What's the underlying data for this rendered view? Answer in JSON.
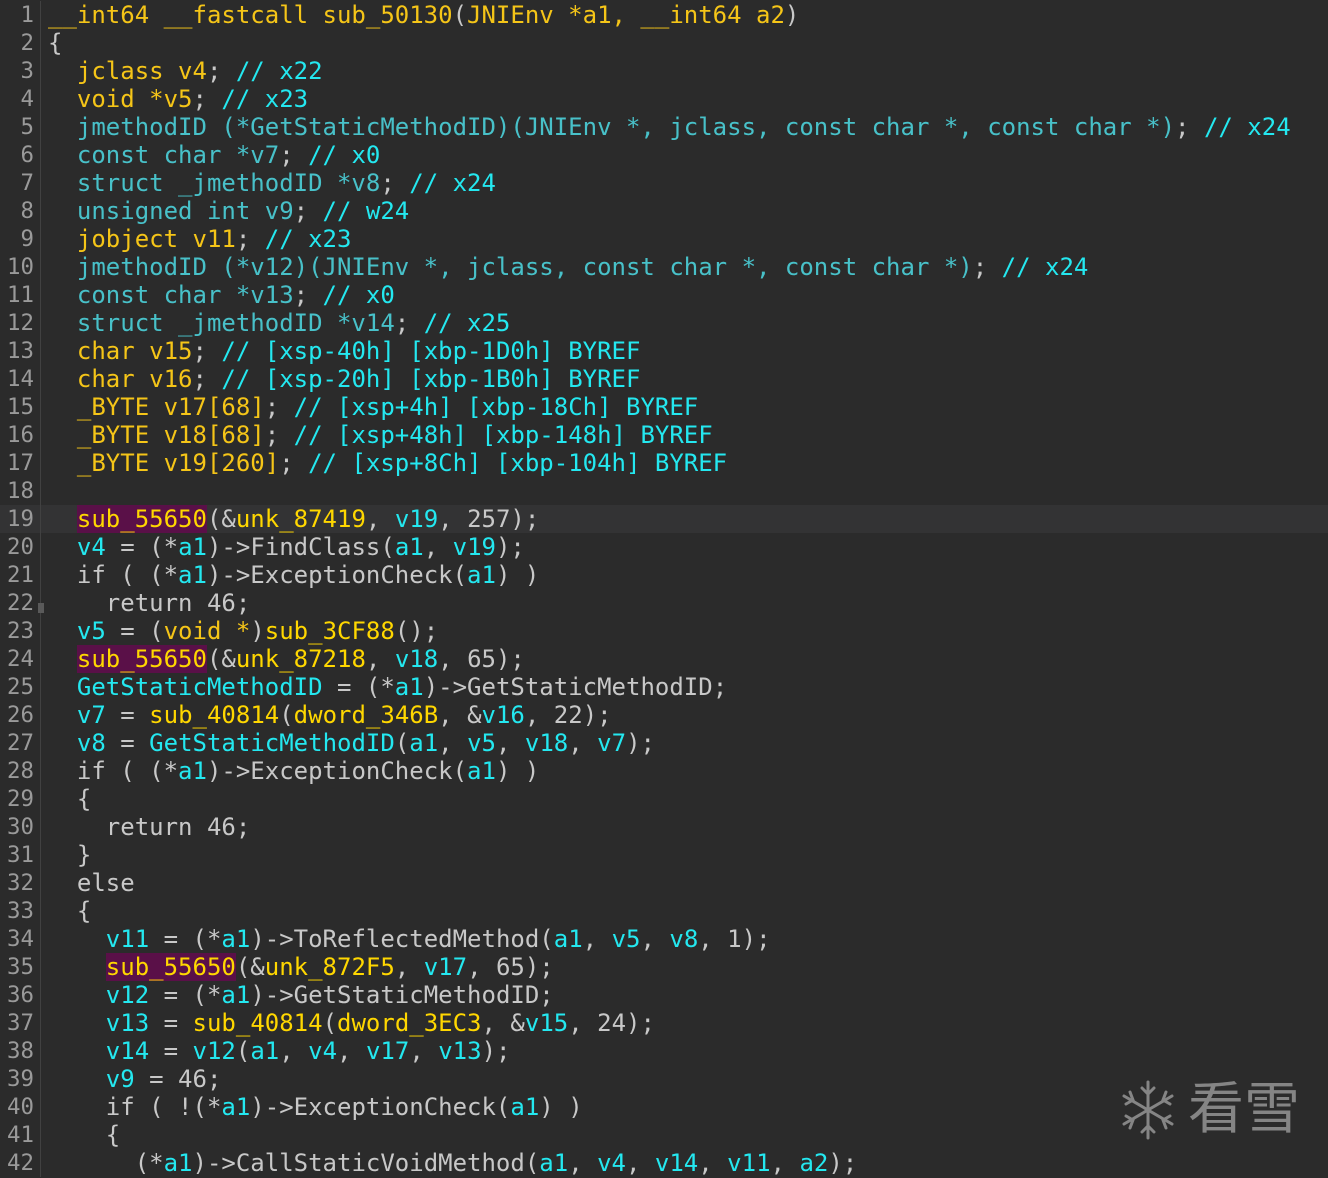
{
  "palette": {
    "default": "#c8c8c8",
    "type": "#f5c518",
    "typeBlue": "#48c1c9",
    "var": "#24e8f0",
    "comment": "#24e8f0",
    "number": "#bdbdbd",
    "func": "#ffd700",
    "funcHighlight": "#5a1048",
    "keyword": "#c8c8c8"
  },
  "highlighted_line": 19,
  "lines": [
    {
      "n": "1",
      "tokens": [
        {
          "t": "__int64 __fastcall sub_50130",
          "c": "type"
        },
        {
          "t": "(",
          "c": "default"
        },
        {
          "t": "JNIEnv *a1, __int64 a2",
          "c": "type"
        },
        {
          "t": ")",
          "c": "default"
        }
      ]
    },
    {
      "n": "2",
      "tokens": [
        {
          "t": "{",
          "c": "default"
        }
      ]
    },
    {
      "n": "3",
      "tokens": [
        {
          "t": "  jclass v4",
          "c": "type"
        },
        {
          "t": "; ",
          "c": "default"
        },
        {
          "t": "// x22",
          "c": "comment"
        }
      ]
    },
    {
      "n": "4",
      "tokens": [
        {
          "t": "  void *v5",
          "c": "type"
        },
        {
          "t": "; ",
          "c": "default"
        },
        {
          "t": "// x23",
          "c": "comment"
        }
      ]
    },
    {
      "n": "5",
      "tokens": [
        {
          "t": "  jmethodID (*GetStaticMethodID)(JNIEnv *, jclass, const char *, const char *)",
          "c": "typeBlue"
        },
        {
          "t": "; ",
          "c": "default"
        },
        {
          "t": "// x24",
          "c": "comment"
        }
      ]
    },
    {
      "n": "6",
      "tokens": [
        {
          "t": "  const char *v7",
          "c": "typeBlue"
        },
        {
          "t": "; ",
          "c": "default"
        },
        {
          "t": "// x0",
          "c": "comment"
        }
      ]
    },
    {
      "n": "7",
      "tokens": [
        {
          "t": "  struct _jmethodID *v8",
          "c": "typeBlue"
        },
        {
          "t": "; ",
          "c": "default"
        },
        {
          "t": "// x24",
          "c": "comment"
        }
      ]
    },
    {
      "n": "8",
      "tokens": [
        {
          "t": "  unsigned int v9",
          "c": "typeBlue"
        },
        {
          "t": "; ",
          "c": "default"
        },
        {
          "t": "// w24",
          "c": "comment"
        }
      ]
    },
    {
      "n": "9",
      "tokens": [
        {
          "t": "  jobject v11",
          "c": "type"
        },
        {
          "t": "; ",
          "c": "default"
        },
        {
          "t": "// x23",
          "c": "comment"
        }
      ]
    },
    {
      "n": "10",
      "tokens": [
        {
          "t": "  jmethodID (*v12)(JNIEnv *, jclass, const char *, const char *)",
          "c": "typeBlue"
        },
        {
          "t": "; ",
          "c": "default"
        },
        {
          "t": "// x24",
          "c": "comment"
        }
      ]
    },
    {
      "n": "11",
      "tokens": [
        {
          "t": "  const char *v13",
          "c": "typeBlue"
        },
        {
          "t": "; ",
          "c": "default"
        },
        {
          "t": "// x0",
          "c": "comment"
        }
      ]
    },
    {
      "n": "12",
      "tokens": [
        {
          "t": "  struct _jmethodID *v14",
          "c": "typeBlue"
        },
        {
          "t": "; ",
          "c": "default"
        },
        {
          "t": "// x25",
          "c": "comment"
        }
      ]
    },
    {
      "n": "13",
      "tokens": [
        {
          "t": "  char v15",
          "c": "type"
        },
        {
          "t": "; ",
          "c": "default"
        },
        {
          "t": "// [xsp-40h] [xbp-1D0h] BYREF",
          "c": "comment"
        }
      ]
    },
    {
      "n": "14",
      "tokens": [
        {
          "t": "  char v16",
          "c": "type"
        },
        {
          "t": "; ",
          "c": "default"
        },
        {
          "t": "// [xsp-20h] [xbp-1B0h] BYREF",
          "c": "comment"
        }
      ]
    },
    {
      "n": "15",
      "tokens": [
        {
          "t": "  _BYTE v17[68]",
          "c": "type"
        },
        {
          "t": "; ",
          "c": "default"
        },
        {
          "t": "// [xsp+4h] [xbp-18Ch] BYREF",
          "c": "comment"
        }
      ]
    },
    {
      "n": "16",
      "tokens": [
        {
          "t": "  _BYTE v18[68]",
          "c": "type"
        },
        {
          "t": "; ",
          "c": "default"
        },
        {
          "t": "// [xsp+48h] [xbp-148h] BYREF",
          "c": "comment"
        }
      ]
    },
    {
      "n": "17",
      "tokens": [
        {
          "t": "  _BYTE v19[260]",
          "c": "type"
        },
        {
          "t": "; ",
          "c": "default"
        },
        {
          "t": "// [xsp+8Ch] [xbp-104h] BYREF",
          "c": "comment"
        }
      ]
    },
    {
      "n": "18",
      "tokens": []
    },
    {
      "n": "19",
      "tokens": [
        {
          "t": "  ",
          "c": "default"
        },
        {
          "t": "sub_55650",
          "c": "funcHl"
        },
        {
          "t": "(&",
          "c": "default"
        },
        {
          "t": "unk_87419",
          "c": "func"
        },
        {
          "t": ", ",
          "c": "default"
        },
        {
          "t": "v19",
          "c": "var"
        },
        {
          "t": ", 257);",
          "c": "default"
        }
      ]
    },
    {
      "n": "20",
      "tokens": [
        {
          "t": "  ",
          "c": "default"
        },
        {
          "t": "v4",
          "c": "var"
        },
        {
          "t": " = (*",
          "c": "default"
        },
        {
          "t": "a1",
          "c": "var"
        },
        {
          "t": ")->FindClass(",
          "c": "default"
        },
        {
          "t": "a1",
          "c": "var"
        },
        {
          "t": ", ",
          "c": "default"
        },
        {
          "t": "v19",
          "c": "var"
        },
        {
          "t": ");",
          "c": "default"
        }
      ]
    },
    {
      "n": "21",
      "tokens": [
        {
          "t": "  if ( (*",
          "c": "default"
        },
        {
          "t": "a1",
          "c": "var"
        },
        {
          "t": ")->ExceptionCheck(",
          "c": "default"
        },
        {
          "t": "a1",
          "c": "var"
        },
        {
          "t": ") )",
          "c": "default"
        }
      ]
    },
    {
      "n": "22",
      "tokens": [
        {
          "t": "    return 46;",
          "c": "default"
        }
      ]
    },
    {
      "n": "23",
      "tokens": [
        {
          "t": "  ",
          "c": "default"
        },
        {
          "t": "v5",
          "c": "var"
        },
        {
          "t": " = (",
          "c": "default"
        },
        {
          "t": "void *",
          "c": "type"
        },
        {
          "t": ")",
          "c": "default"
        },
        {
          "t": "sub_3CF88",
          "c": "func"
        },
        {
          "t": "();",
          "c": "default"
        }
      ]
    },
    {
      "n": "24",
      "tokens": [
        {
          "t": "  ",
          "c": "default"
        },
        {
          "t": "sub_55650",
          "c": "funcHl"
        },
        {
          "t": "(&",
          "c": "default"
        },
        {
          "t": "unk_87218",
          "c": "func"
        },
        {
          "t": ", ",
          "c": "default"
        },
        {
          "t": "v18",
          "c": "var"
        },
        {
          "t": ", 65);",
          "c": "default"
        }
      ]
    },
    {
      "n": "25",
      "tokens": [
        {
          "t": "  ",
          "c": "default"
        },
        {
          "t": "GetStaticMethodID",
          "c": "var"
        },
        {
          "t": " = (*",
          "c": "default"
        },
        {
          "t": "a1",
          "c": "var"
        },
        {
          "t": ")->GetStaticMethodID;",
          "c": "default"
        }
      ]
    },
    {
      "n": "26",
      "tokens": [
        {
          "t": "  ",
          "c": "default"
        },
        {
          "t": "v7",
          "c": "var"
        },
        {
          "t": " = ",
          "c": "default"
        },
        {
          "t": "sub_40814",
          "c": "func"
        },
        {
          "t": "(",
          "c": "default"
        },
        {
          "t": "dword_346B",
          "c": "func"
        },
        {
          "t": ", &",
          "c": "default"
        },
        {
          "t": "v16",
          "c": "var"
        },
        {
          "t": ", 22);",
          "c": "default"
        }
      ]
    },
    {
      "n": "27",
      "tokens": [
        {
          "t": "  ",
          "c": "default"
        },
        {
          "t": "v8",
          "c": "var"
        },
        {
          "t": " = ",
          "c": "default"
        },
        {
          "t": "GetStaticMethodID",
          "c": "var"
        },
        {
          "t": "(",
          "c": "default"
        },
        {
          "t": "a1",
          "c": "var"
        },
        {
          "t": ", ",
          "c": "default"
        },
        {
          "t": "v5",
          "c": "var"
        },
        {
          "t": ", ",
          "c": "default"
        },
        {
          "t": "v18",
          "c": "var"
        },
        {
          "t": ", ",
          "c": "default"
        },
        {
          "t": "v7",
          "c": "var"
        },
        {
          "t": ");",
          "c": "default"
        }
      ]
    },
    {
      "n": "28",
      "tokens": [
        {
          "t": "  if ( (*",
          "c": "default"
        },
        {
          "t": "a1",
          "c": "var"
        },
        {
          "t": ")->ExceptionCheck(",
          "c": "default"
        },
        {
          "t": "a1",
          "c": "var"
        },
        {
          "t": ") )",
          "c": "default"
        }
      ]
    },
    {
      "n": "29",
      "tokens": [
        {
          "t": "  {",
          "c": "default"
        }
      ]
    },
    {
      "n": "30",
      "tokens": [
        {
          "t": "    return 46;",
          "c": "default"
        }
      ]
    },
    {
      "n": "31",
      "tokens": [
        {
          "t": "  }",
          "c": "default"
        }
      ]
    },
    {
      "n": "32",
      "tokens": [
        {
          "t": "  else",
          "c": "default"
        }
      ]
    },
    {
      "n": "33",
      "tokens": [
        {
          "t": "  {",
          "c": "default"
        }
      ]
    },
    {
      "n": "34",
      "tokens": [
        {
          "t": "    ",
          "c": "default"
        },
        {
          "t": "v11",
          "c": "var"
        },
        {
          "t": " = (*",
          "c": "default"
        },
        {
          "t": "a1",
          "c": "var"
        },
        {
          "t": ")->ToReflectedMethod(",
          "c": "default"
        },
        {
          "t": "a1",
          "c": "var"
        },
        {
          "t": ", ",
          "c": "default"
        },
        {
          "t": "v5",
          "c": "var"
        },
        {
          "t": ", ",
          "c": "default"
        },
        {
          "t": "v8",
          "c": "var"
        },
        {
          "t": ", 1);",
          "c": "default"
        }
      ]
    },
    {
      "n": "35",
      "tokens": [
        {
          "t": "    ",
          "c": "default"
        },
        {
          "t": "sub_55650",
          "c": "funcHl"
        },
        {
          "t": "(&",
          "c": "default"
        },
        {
          "t": "unk_872F5",
          "c": "func"
        },
        {
          "t": ", ",
          "c": "default"
        },
        {
          "t": "v17",
          "c": "var"
        },
        {
          "t": ", 65);",
          "c": "default"
        }
      ]
    },
    {
      "n": "36",
      "tokens": [
        {
          "t": "    ",
          "c": "default"
        },
        {
          "t": "v12",
          "c": "var"
        },
        {
          "t": " = (*",
          "c": "default"
        },
        {
          "t": "a1",
          "c": "var"
        },
        {
          "t": ")->GetStaticMethodID;",
          "c": "default"
        }
      ]
    },
    {
      "n": "37",
      "tokens": [
        {
          "t": "    ",
          "c": "default"
        },
        {
          "t": "v13",
          "c": "var"
        },
        {
          "t": " = ",
          "c": "default"
        },
        {
          "t": "sub_40814",
          "c": "func"
        },
        {
          "t": "(",
          "c": "default"
        },
        {
          "t": "dword_3EC3",
          "c": "func"
        },
        {
          "t": ", &",
          "c": "default"
        },
        {
          "t": "v15",
          "c": "var"
        },
        {
          "t": ", 24);",
          "c": "default"
        }
      ]
    },
    {
      "n": "38",
      "tokens": [
        {
          "t": "    ",
          "c": "default"
        },
        {
          "t": "v14",
          "c": "var"
        },
        {
          "t": " = ",
          "c": "default"
        },
        {
          "t": "v12",
          "c": "var"
        },
        {
          "t": "(",
          "c": "default"
        },
        {
          "t": "a1",
          "c": "var"
        },
        {
          "t": ", ",
          "c": "default"
        },
        {
          "t": "v4",
          "c": "var"
        },
        {
          "t": ", ",
          "c": "default"
        },
        {
          "t": "v17",
          "c": "var"
        },
        {
          "t": ", ",
          "c": "default"
        },
        {
          "t": "v13",
          "c": "var"
        },
        {
          "t": ");",
          "c": "default"
        }
      ]
    },
    {
      "n": "39",
      "tokens": [
        {
          "t": "    ",
          "c": "default"
        },
        {
          "t": "v9",
          "c": "var"
        },
        {
          "t": " = 46;",
          "c": "default"
        }
      ]
    },
    {
      "n": "40",
      "tokens": [
        {
          "t": "    if ( !(*",
          "c": "default"
        },
        {
          "t": "a1",
          "c": "var"
        },
        {
          "t": ")->ExceptionCheck(",
          "c": "default"
        },
        {
          "t": "a1",
          "c": "var"
        },
        {
          "t": ") )",
          "c": "default"
        }
      ]
    },
    {
      "n": "41",
      "tokens": [
        {
          "t": "    {",
          "c": "default"
        }
      ]
    },
    {
      "n": "42",
      "tokens": [
        {
          "t": "      (*",
          "c": "default"
        },
        {
          "t": "a1",
          "c": "var"
        },
        {
          "t": ")->CallStaticVoidMethod(",
          "c": "default"
        },
        {
          "t": "a1",
          "c": "var"
        },
        {
          "t": ", ",
          "c": "default"
        },
        {
          "t": "v4",
          "c": "var"
        },
        {
          "t": ", ",
          "c": "default"
        },
        {
          "t": "v14",
          "c": "var"
        },
        {
          "t": ", ",
          "c": "default"
        },
        {
          "t": "v11",
          "c": "var"
        },
        {
          "t": ", ",
          "c": "default"
        },
        {
          "t": "a2",
          "c": "var"
        },
        {
          "t": ");",
          "c": "default"
        }
      ]
    }
  ],
  "watermark": {
    "text": "看雪",
    "icon": "snowflake-icon"
  }
}
